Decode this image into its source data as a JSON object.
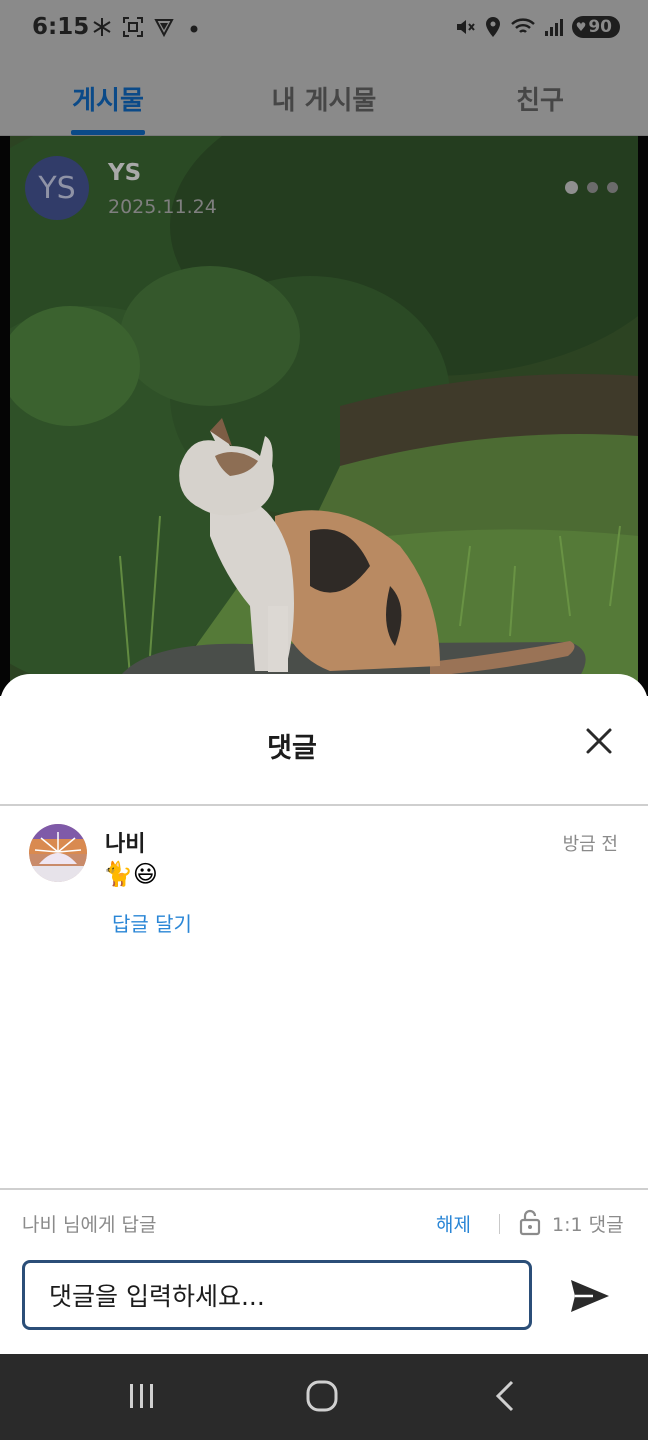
{
  "status_bar": {
    "time": "6:15",
    "battery": "90",
    "left_icons": [
      "snowflake-icon",
      "screenshot-icon",
      "vpn-shield-icon",
      "dot-icon"
    ],
    "right_icons": [
      "mute-icon",
      "location-icon",
      "wifi-icon",
      "signal-icon",
      "battery-icon"
    ]
  },
  "tabs": [
    {
      "label": "게시물",
      "active": true
    },
    {
      "label": "내 게시물",
      "active": false
    },
    {
      "label": "친구",
      "active": false
    }
  ],
  "post": {
    "avatar_initials": "YS",
    "author": "YS",
    "date": "2025.11.24",
    "page_count": 3,
    "current_page": 1
  },
  "comments_sheet": {
    "title": "댓글",
    "comments": [
      {
        "name": "나비",
        "text": "🐈😃",
        "time": "방금 전",
        "reply_label": "답글 달기"
      }
    ],
    "reply_target": "나비 님에게 답글",
    "cancel_label": "해제",
    "private_label": "1:1 댓글",
    "input_placeholder": "댓글을 입력하세요..."
  },
  "colors": {
    "accent": "#0b4a88",
    "link": "#2a86d6",
    "avatar_bg": "#313c69"
  }
}
